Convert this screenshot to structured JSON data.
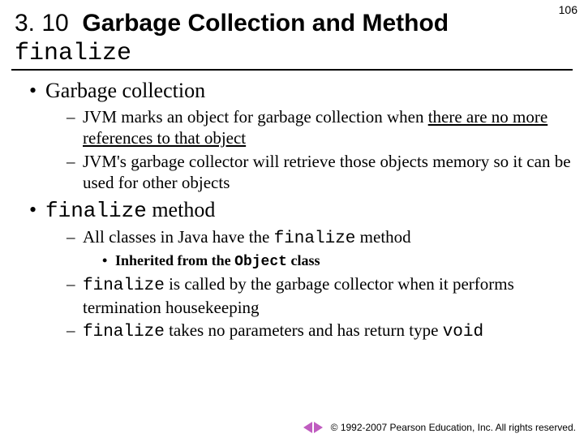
{
  "page_number": "106",
  "title": {
    "section": "3. 10",
    "text_part1": "Garbage Collection and Method",
    "code": "finalize"
  },
  "b1": {
    "heading": "Garbage collection",
    "s1a": "JVM marks an object for garbage collection when ",
    "s1b": "there are no more references to that object",
    "s2": "JVM's garbage collector will retrieve those objects memory so it can be used for other objects"
  },
  "b2": {
    "heading_code": "finalize",
    "heading_rest": " method",
    "s1a": "All classes in Java have the ",
    "s1b": "finalize",
    "s1c": " method",
    "ss1a": "Inherited from the ",
    "ss1b": "Object",
    "ss1c": " class",
    "s2a": "finalize",
    "s2b": " is called by the garbage collector when it performs termination housekeeping",
    "s3a": "finalize",
    "s3b": " takes no parameters and has return type ",
    "s3c": "void"
  },
  "footer": {
    "copyright": "© 1992-2007 Pearson Education, Inc.  All rights reserved."
  }
}
